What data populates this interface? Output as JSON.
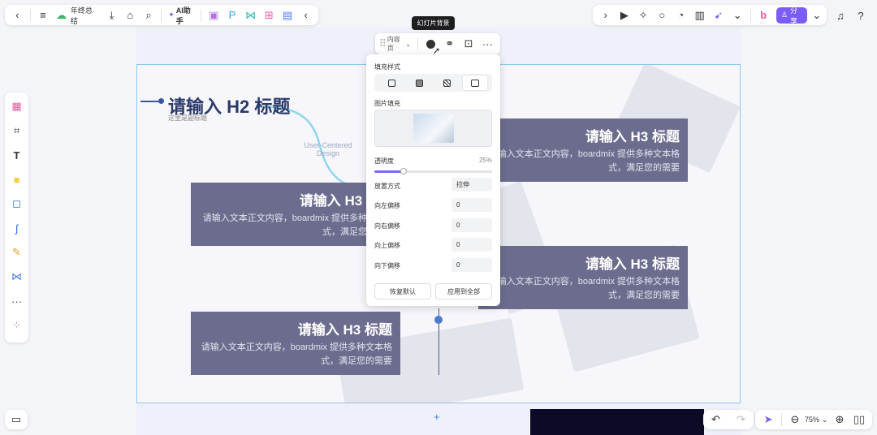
{
  "doc": {
    "title": "年终总结"
  },
  "top_toolbar": {
    "ai_label": "AI助手"
  },
  "right_toolbar": {
    "share_label": "分享"
  },
  "tooltip": "幻灯片背景",
  "mini_toolbar": {
    "page_type": "内容页"
  },
  "panel": {
    "fill_style_label": "填充样式",
    "image_fill_label": "图片填充",
    "opacity_label": "透明度",
    "opacity_value": "25%",
    "opacity_fraction": 0.25,
    "placement_label": "放置方式",
    "placement_value": "拉伸",
    "offset_left_label": "向左偏移",
    "offset_left_value": "0",
    "offset_right_label": "向右偏移",
    "offset_right_value": "0",
    "offset_up_label": "向上偏移",
    "offset_up_value": "0",
    "offset_down_label": "向下偏移",
    "offset_down_value": "0",
    "reset_label": "恢复默认",
    "apply_all_label": "应用到全部"
  },
  "slide": {
    "h2_title": "请输入 H2 标题",
    "h2_subtitle": "这里是副标题",
    "ghost_text": "User-Centered Design",
    "cards": [
      {
        "title": "请输入 H3 标题",
        "body": "请输入文本正文内容，boardmix 提供多种文本格式，满足您的需要"
      },
      {
        "title": "请输入 H3 标题",
        "body": "请输入文本正文内容，boardmix 提供多种文本格式，满足您的需要"
      },
      {
        "title": "请输入 H3 标题",
        "body": "请输入文本正文内容，boardmix 提供多种文本格式，满足您的需要"
      },
      {
        "title": "请输入 H3 标题",
        "body": "请输入文本正文内容，boardmix 提供多种文本格式，满足您的需要"
      }
    ]
  },
  "zoom": {
    "level": "75%"
  }
}
